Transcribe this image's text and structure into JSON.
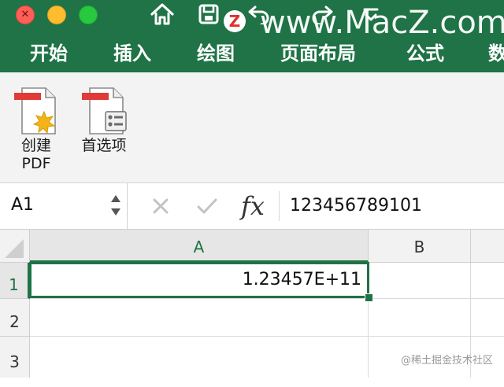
{
  "window": {
    "controls": [
      "close",
      "minimize",
      "zoom"
    ],
    "toolbar_icons": [
      "home-icon",
      "save-icon",
      "undo-icon",
      "redo-icon",
      "more-icon"
    ]
  },
  "watermark": {
    "logo_letter": "Z",
    "text": "www.MacZ.com"
  },
  "ribbon_tabs": [
    {
      "label": "开始"
    },
    {
      "label": "插入"
    },
    {
      "label": "绘图"
    },
    {
      "label": "页面布局"
    },
    {
      "label": "公式"
    },
    {
      "label": "数"
    }
  ],
  "ribbon_buttons": [
    {
      "label_line1": "创建",
      "label_line2": "PDF",
      "icon": "create-pdf-icon"
    },
    {
      "label_line1": "首选项",
      "label_line2": "",
      "icon": "preferences-icon"
    }
  ],
  "formula_bar": {
    "name_box": "A1",
    "fx": "fx",
    "content": "123456789101"
  },
  "sheet": {
    "columns": [
      "A",
      "B"
    ],
    "rows": [
      "1",
      "2",
      "3"
    ],
    "cells": {
      "A1": "1.23457E+11"
    },
    "active_cell": "A1"
  },
  "credit": "@稀土掘金技术社区",
  "colors": {
    "accent": "#1f7346",
    "ribbon_bg": "#f3f3f3"
  }
}
